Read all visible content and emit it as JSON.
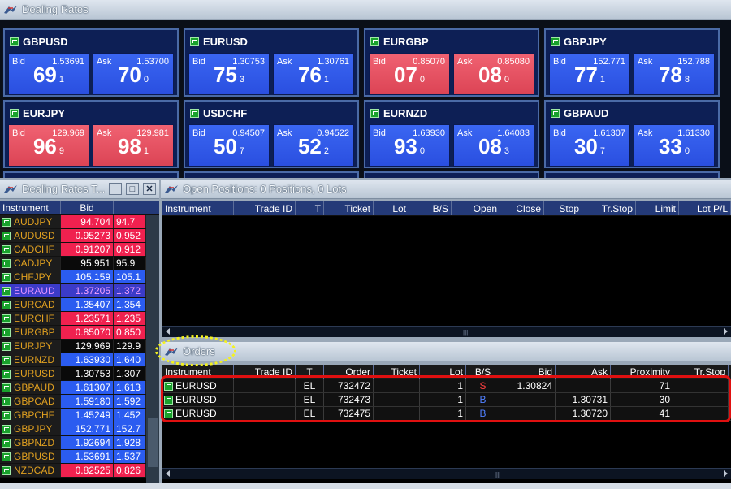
{
  "rates_window": {
    "title": "Dealing Rates"
  },
  "tiles": [
    {
      "symbol": "GBPUSD",
      "bid_label": "Bid",
      "bid": "1.53691",
      "bid_big": "69",
      "bid_small": "1",
      "ask_label": "Ask",
      "ask": "1.53700",
      "ask_big": "70",
      "ask_small": "0",
      "color": "blue"
    },
    {
      "symbol": "EURUSD",
      "bid_label": "Bid",
      "bid": "1.30753",
      "bid_big": "75",
      "bid_small": "3",
      "ask_label": "Ask",
      "ask": "1.30761",
      "ask_big": "76",
      "ask_small": "1",
      "color": "blue"
    },
    {
      "symbol": "EURGBP",
      "bid_label": "Bid",
      "bid": "0.85070",
      "bid_big": "07",
      "bid_small": "0",
      "ask_label": "Ask",
      "ask": "0.85080",
      "ask_big": "08",
      "ask_small": "0",
      "color": "red"
    },
    {
      "symbol": "GBPJPY",
      "bid_label": "Bid",
      "bid": "152.771",
      "bid_big": "77",
      "bid_small": "1",
      "ask_label": "Ask",
      "ask": "152.788",
      "ask_big": "78",
      "ask_small": "8",
      "color": "blue"
    },
    {
      "symbol": "EURJPY",
      "bid_label": "Bid",
      "bid": "129.969",
      "bid_big": "96",
      "bid_small": "9",
      "ask_label": "Ask",
      "ask": "129.981",
      "ask_big": "98",
      "ask_small": "1",
      "color": "red"
    },
    {
      "symbol": "USDCHF",
      "bid_label": "Bid",
      "bid": "0.94507",
      "bid_big": "50",
      "bid_small": "7",
      "ask_label": "Ask",
      "ask": "0.94522",
      "ask_big": "52",
      "ask_small": "2",
      "color": "blue"
    },
    {
      "symbol": "EURNZD",
      "bid_label": "Bid",
      "bid": "1.63930",
      "bid_big": "93",
      "bid_small": "0",
      "ask_label": "Ask",
      "ask": "1.64083",
      "ask_big": "08",
      "ask_small": "3",
      "color": "blue"
    },
    {
      "symbol": "GBPAUD",
      "bid_label": "Bid",
      "bid": "1.61307",
      "bid_big": "30",
      "bid_small": "7",
      "ask_label": "Ask",
      "ask": "1.61330",
      "ask_big": "33",
      "ask_small": "0",
      "color": "blue"
    }
  ],
  "watchlist": {
    "title": "Dealing Rates T...",
    "columns": [
      "Instrument",
      "Bid"
    ],
    "rows": [
      {
        "symbol": "AUDJPY",
        "bid": "94.704",
        "ask": "94.7",
        "dir": "down"
      },
      {
        "symbol": "AUDUSD",
        "bid": "0.95273",
        "ask": "0.952",
        "dir": "down"
      },
      {
        "symbol": "CADCHF",
        "bid": "0.91207",
        "ask": "0.912",
        "dir": "down"
      },
      {
        "symbol": "CADJPY",
        "bid": "95.951",
        "ask": "95.9",
        "dir": "neutral"
      },
      {
        "symbol": "CHFJPY",
        "bid": "105.159",
        "ask": "105.1",
        "dir": "up"
      },
      {
        "symbol": "EURAUD",
        "bid": "1.37205",
        "ask": "1.372",
        "dir": "up",
        "highlight": true
      },
      {
        "symbol": "EURCAD",
        "bid": "1.35407",
        "ask": "1.354",
        "dir": "up"
      },
      {
        "symbol": "EURCHF",
        "bid": "1.23571",
        "ask": "1.235",
        "dir": "down"
      },
      {
        "symbol": "EURGBP",
        "bid": "0.85070",
        "ask": "0.850",
        "dir": "down"
      },
      {
        "symbol": "EURJPY",
        "bid": "129.969",
        "ask": "129.9",
        "dir": "neutral"
      },
      {
        "symbol": "EURNZD",
        "bid": "1.63930",
        "ask": "1.640",
        "dir": "up"
      },
      {
        "symbol": "EURUSD",
        "bid": "1.30753",
        "ask": "1.307",
        "dir": "neutral"
      },
      {
        "symbol": "GBPAUD",
        "bid": "1.61307",
        "ask": "1.613",
        "dir": "up"
      },
      {
        "symbol": "GBPCAD",
        "bid": "1.59180",
        "ask": "1.592",
        "dir": "up"
      },
      {
        "symbol": "GBPCHF",
        "bid": "1.45249",
        "ask": "1.452",
        "dir": "up"
      },
      {
        "symbol": "GBPJPY",
        "bid": "152.771",
        "ask": "152.7",
        "dir": "up"
      },
      {
        "symbol": "GBPNZD",
        "bid": "1.92694",
        "ask": "1.928",
        "dir": "up"
      },
      {
        "symbol": "GBPUSD",
        "bid": "1.53691",
        "ask": "1.537",
        "dir": "up"
      },
      {
        "symbol": "NZDCAD",
        "bid": "0.82525",
        "ask": "0.826",
        "dir": "down"
      }
    ]
  },
  "positions": {
    "title": "Open Positions: 0 Positions, 0 Lots",
    "columns": [
      "Instrument",
      "Trade ID",
      "T",
      "Ticket",
      "Lot",
      "B/S",
      "Open",
      "Close",
      "Stop",
      "Tr.Stop",
      "Limit",
      "Lot P/L"
    ]
  },
  "orders": {
    "title": "Orders",
    "columns": [
      "Instrument",
      "Trade ID",
      "T",
      "Order",
      "Ticket",
      "Lot",
      "B/S",
      "Bid",
      "Ask",
      "Proximity",
      "Tr.Stop"
    ],
    "rows": [
      {
        "instrument": "EURUSD",
        "trade_id": "",
        "t": "EL",
        "order": "732472",
        "ticket": "",
        "lot": "1",
        "bs": "S",
        "bid": "1.30824",
        "ask": "",
        "proximity": "71",
        "trstop": ""
      },
      {
        "instrument": "EURUSD",
        "trade_id": "",
        "t": "EL",
        "order": "732473",
        "ticket": "",
        "lot": "1",
        "bs": "B",
        "bid": "",
        "ask": "1.30731",
        "proximity": "30",
        "trstop": ""
      },
      {
        "instrument": "EURUSD",
        "trade_id": "",
        "t": "EL",
        "order": "732475",
        "ticket": "",
        "lot": "1",
        "bs": "B",
        "bid": "",
        "ask": "1.30720",
        "proximity": "41",
        "trstop": ""
      }
    ]
  },
  "colors": {
    "tile_blue": "#2a4fe0",
    "tile_red": "#dc4455",
    "annotation_yellow": "#f4f21e",
    "annotation_red": "#e01010",
    "sell": "#ff4040",
    "buy": "#5080ff"
  }
}
